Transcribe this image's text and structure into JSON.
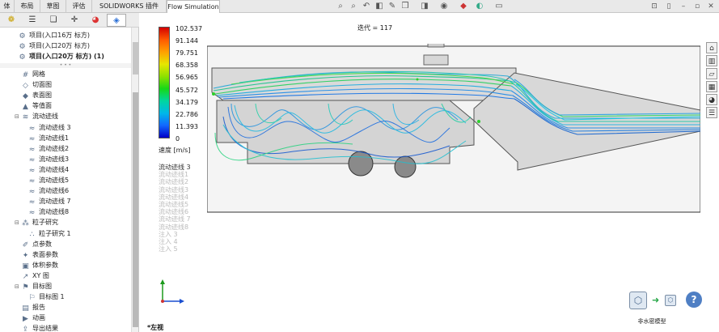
{
  "tabs": [
    {
      "label": "体"
    },
    {
      "label": "布局"
    },
    {
      "label": "草图"
    },
    {
      "label": "评估"
    },
    {
      "label": "SOLIDWORKS 插件"
    },
    {
      "label": "Flow Simulation"
    }
  ],
  "active_tab": "Flow Simulation",
  "toolbar_icons": [
    "zoom-to-fit-icon",
    "zoom-area-icon",
    "previous-view-icon",
    "section-view-icon",
    "dynamic-annotation-icon",
    "view-orientation-icon",
    "display-style-icon",
    "hide-show-icon",
    "edit-appearance-icon",
    "apply-scene-icon",
    "view-settings-icon"
  ],
  "window_controls": [
    "restore-icon",
    "tile-icon",
    "minimize-icon",
    "maximize-icon",
    "close-icon"
  ],
  "panel_tabs": [
    "feature-manager-icon",
    "property-manager-icon",
    "configuration-manager-icon",
    "dimxpert-icon",
    "display-manager-icon",
    "flow-simulation-icon"
  ],
  "tree_top": [
    {
      "label": "项目(入口16万 标方)",
      "icon": "project-icon"
    },
    {
      "label": "项目(入口20万 标方)",
      "icon": "project-icon"
    },
    {
      "label": "项目(入口20万 标方)  (1)",
      "icon": "project-icon",
      "bold": true
    }
  ],
  "tree": [
    {
      "label": "网格",
      "icon": "mesh-icon",
      "indent": 1
    },
    {
      "label": "切面图",
      "icon": "cut-plot-icon",
      "indent": 1
    },
    {
      "label": "表面图",
      "icon": "surface-plot-icon",
      "indent": 1
    },
    {
      "label": "等值面",
      "icon": "isosurface-icon",
      "indent": 1
    },
    {
      "label": "流动迹线",
      "icon": "flow-trajectories-icon",
      "indent": 1,
      "expanded": true
    },
    {
      "label": "流动迹线 3",
      "icon": "trajectory-item-icon",
      "indent": 2
    },
    {
      "label": "流动迹线1",
      "icon": "trajectory-item-icon",
      "indent": 2
    },
    {
      "label": "流动迹线2",
      "icon": "trajectory-item-icon",
      "indent": 2
    },
    {
      "label": "流动迹线3",
      "icon": "trajectory-item-icon",
      "indent": 2
    },
    {
      "label": "流动迹线4",
      "icon": "trajectory-item-icon",
      "indent": 2
    },
    {
      "label": "流动迹线5",
      "icon": "trajectory-item-icon",
      "indent": 2
    },
    {
      "label": "流动迹线6",
      "icon": "trajectory-item-icon",
      "indent": 2
    },
    {
      "label": "流动迹线 7",
      "icon": "trajectory-item-icon",
      "indent": 2
    },
    {
      "label": "流动迹线8",
      "icon": "trajectory-item-icon",
      "indent": 2
    },
    {
      "label": "粒子研究",
      "icon": "particle-study-icon",
      "indent": 1,
      "expanded": true
    },
    {
      "label": "粒子研究 1",
      "icon": "particle-study-item-icon",
      "indent": 2
    },
    {
      "label": "点参数",
      "icon": "point-parameters-icon",
      "indent": 1
    },
    {
      "label": "表面参数",
      "icon": "surface-parameters-icon",
      "indent": 1
    },
    {
      "label": "体积参数",
      "icon": "volume-parameters-icon",
      "indent": 1
    },
    {
      "label": "XY 图",
      "icon": "xy-plot-icon",
      "indent": 1
    },
    {
      "label": "目标图",
      "icon": "goal-plot-icon",
      "indent": 1,
      "expanded": true
    },
    {
      "label": "目标图 1",
      "icon": "goal-plot-item-icon",
      "indent": 2
    },
    {
      "label": "报告",
      "icon": "report-icon",
      "indent": 1
    },
    {
      "label": "动画",
      "icon": "animation-icon",
      "indent": 1
    },
    {
      "label": "导出结果",
      "icon": "export-results-icon",
      "indent": 1
    }
  ],
  "legend": {
    "values": [
      "102.537",
      "91.144",
      "79.751",
      "68.358",
      "56.965",
      "45.572",
      "34.179",
      "22.786",
      "11.393",
      "0"
    ],
    "unit": "速度 [m/s]",
    "colors": [
      "#d40000",
      "#ff5a00",
      "#ffa000",
      "#e6e600",
      "#8ee000",
      "#17d817",
      "#00d6a0",
      "#00b8e8",
      "#1268ff",
      "#0000c8"
    ]
  },
  "layers": [
    {
      "label": "流动迹线 3",
      "active": true
    },
    {
      "label": "流动迹线1",
      "active": false
    },
    {
      "label": "流动迹线2",
      "active": false
    },
    {
      "label": "流动迹线3",
      "active": false
    },
    {
      "label": "流动迹线4",
      "active": false
    },
    {
      "label": "流动迹线5",
      "active": false
    },
    {
      "label": "流动迹线6",
      "active": false
    },
    {
      "label": "流动迹线 7",
      "active": false
    },
    {
      "label": "流动迹线8",
      "active": false
    },
    {
      "label": "注入 3",
      "active": false
    },
    {
      "label": "注入 4",
      "active": false
    },
    {
      "label": "注入 5",
      "active": false
    }
  ],
  "iteration_label": "迭代 = 117",
  "view_name": "*左视",
  "right_strip_icons": [
    "home-view-icon",
    "design-library-icon",
    "file-explorer-icon",
    "view-palette-icon",
    "appearances-icon",
    "custom-properties-icon"
  ],
  "nav_widget": {
    "label": "非水密模型",
    "icons": [
      "view-cube-icon",
      "arrow-right-icon",
      "small-cube-icon",
      "help-icon"
    ]
  }
}
